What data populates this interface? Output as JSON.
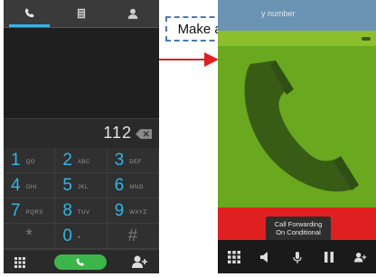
{
  "callout": {
    "label": "Make a call"
  },
  "dialer": {
    "tabs": [
      {
        "icon": "phone-icon",
        "active": true
      },
      {
        "icon": "call-log-icon",
        "active": false
      },
      {
        "icon": "contacts-icon",
        "active": false
      }
    ],
    "entered_number": "112",
    "keys": [
      {
        "digit": "1",
        "letters": "QO"
      },
      {
        "digit": "2",
        "letters": "ABC"
      },
      {
        "digit": "3",
        "letters": "DEF"
      },
      {
        "digit": "4",
        "letters": "GHI"
      },
      {
        "digit": "5",
        "letters": "JKL"
      },
      {
        "digit": "6",
        "letters": "MNO"
      },
      {
        "digit": "7",
        "letters": "PQRS"
      },
      {
        "digit": "8",
        "letters": "TUV"
      },
      {
        "digit": "9",
        "letters": "WXYZ"
      },
      {
        "digit": "*",
        "letters": ""
      },
      {
        "digit": "0",
        "letters": "+"
      },
      {
        "digit": "#",
        "letters": ""
      }
    ],
    "colors": {
      "accent": "#33b5e5",
      "call": "#3cb54a"
    }
  },
  "incall": {
    "header_hint": "y number",
    "toast": {
      "line1": "Call Forwarding",
      "line2": "On Conditional"
    },
    "colors": {
      "header": "#6b93b3",
      "photo": "#6aa81f",
      "end": "#e02020"
    }
  }
}
